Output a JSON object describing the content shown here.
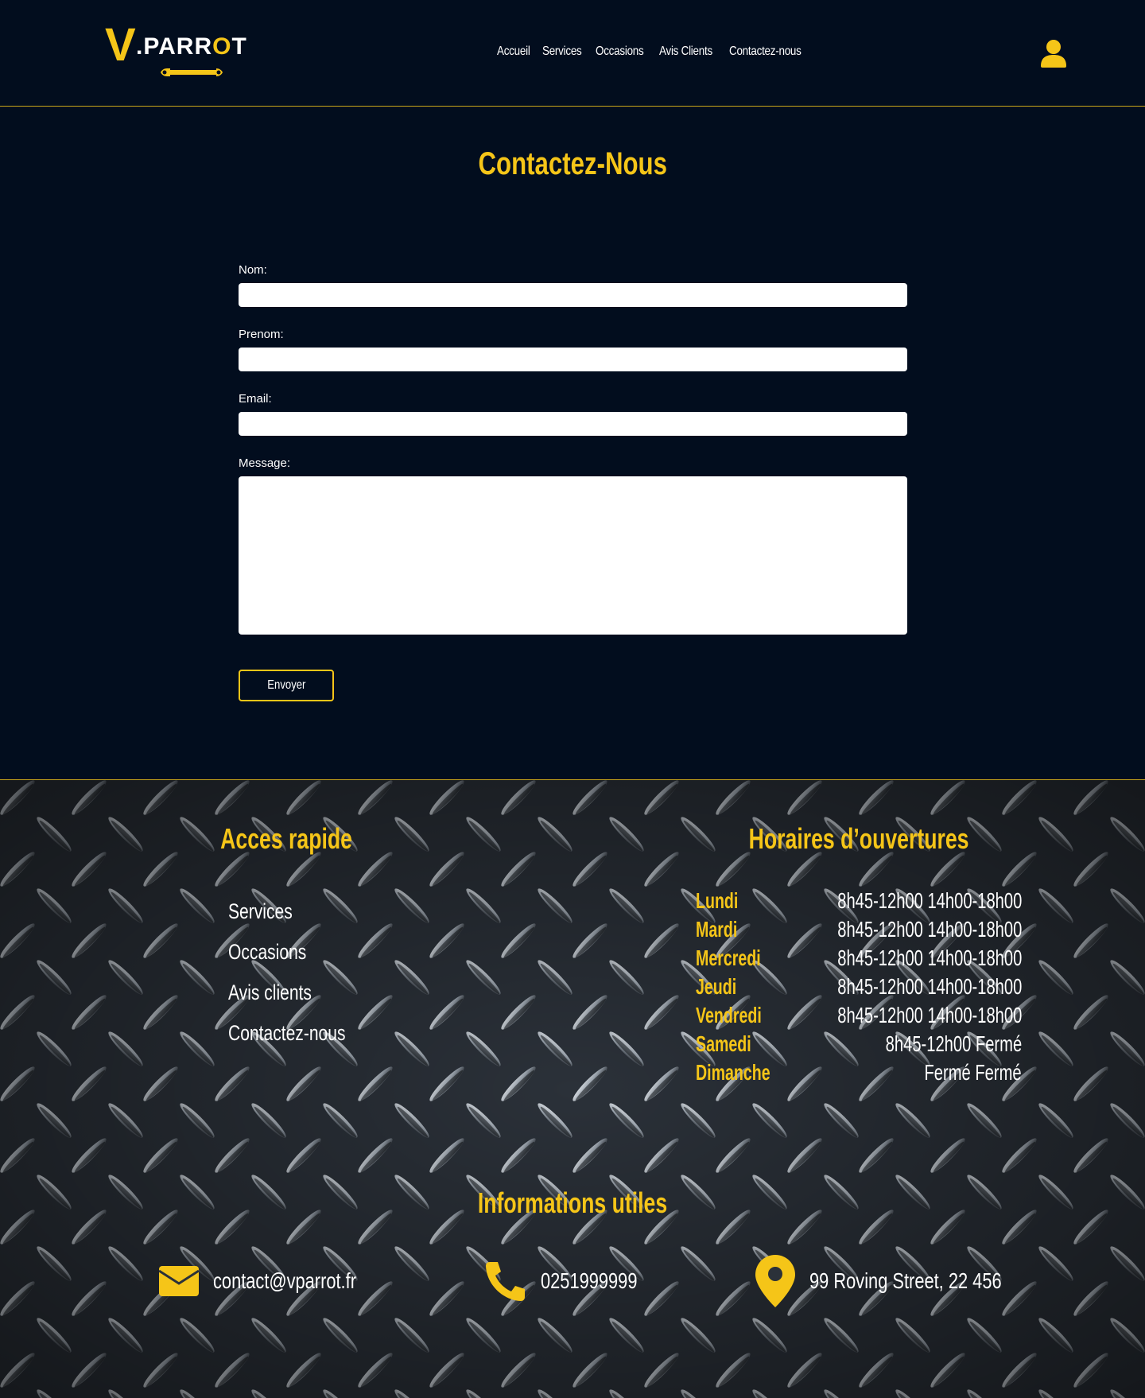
{
  "brand": {
    "logo_letter": "V",
    "logo_name_pre": ".PARR",
    "logo_name_o": "O",
    "logo_name_post": "T",
    "accent_color": "#f5c518",
    "background_color": "#020d1e"
  },
  "nav": {
    "items": [
      {
        "label": "Accueil"
      },
      {
        "label": "Services"
      },
      {
        "label": "Occasions"
      },
      {
        "label": "Avis Clients"
      },
      {
        "label": "Contactez-nous"
      }
    ],
    "user_icon": "user-icon"
  },
  "contact": {
    "title": "Contactez-Nous",
    "fields": {
      "nom": {
        "label": "Nom:",
        "value": ""
      },
      "prenom": {
        "label": "Prenom:",
        "value": ""
      },
      "email": {
        "label": "Email:",
        "value": ""
      },
      "message": {
        "label": "Message:",
        "value": ""
      }
    },
    "submit_label": "Envoyer"
  },
  "footer": {
    "quick_access": {
      "title": "Acces rapide",
      "links": [
        {
          "label": "Services"
        },
        {
          "label": "Occasions"
        },
        {
          "label": "Avis clients"
        },
        {
          "label": "Contactez-nous"
        }
      ]
    },
    "hours": {
      "title": "Horaires d’ouvertures",
      "rows": [
        {
          "day": "Lundi",
          "times": "8h45-12h00  14h00-18h00"
        },
        {
          "day": "Mardi",
          "times": "8h45-12h00  14h00-18h00"
        },
        {
          "day": "Mercredi",
          "times": "8h45-12h00  14h00-18h00"
        },
        {
          "day": "Jeudi",
          "times": "8h45-12h00  14h00-18h00"
        },
        {
          "day": "Vendredi",
          "times": "8h45-12h00  14h00-18h00"
        },
        {
          "day": "Samedi",
          "times": "8h45-12h00  Fermé"
        },
        {
          "day": "Dimanche",
          "times": "Fermé  Fermé"
        }
      ]
    },
    "info": {
      "title": "Informations utiles",
      "email": {
        "icon": "envelope-icon",
        "text": "contact@vparrot.fr"
      },
      "phone": {
        "icon": "phone-icon",
        "text": "0251999999"
      },
      "address": {
        "icon": "map-pin-icon",
        "text": "99 Roving Street, 22 456"
      }
    }
  }
}
